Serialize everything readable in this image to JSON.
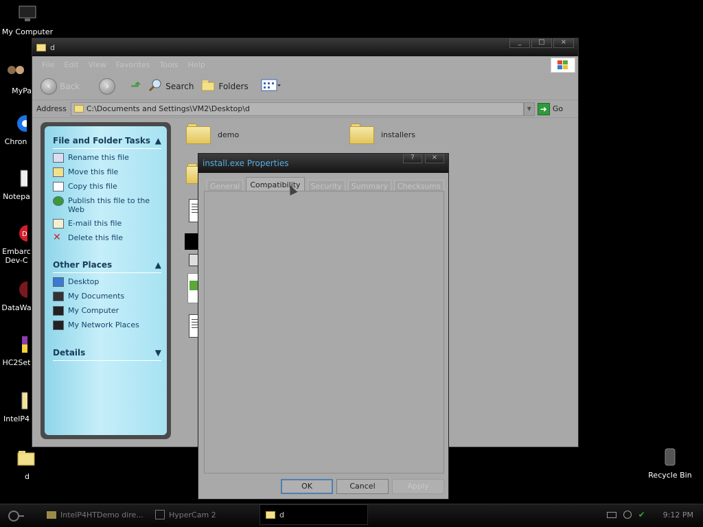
{
  "desktop": {
    "icons": [
      {
        "label": "My Computer",
        "icon": "monitor-icon"
      },
      {
        "label": "MyPa",
        "icon": "app-icon"
      },
      {
        "label": "Chron",
        "icon": "chrome-icon"
      },
      {
        "label": "Notepa",
        "icon": "notepad-icon"
      },
      {
        "label": "Embarc",
        "label2": "Dev-C",
        "icon": "embarcadero-icon"
      },
      {
        "label": "DataWa",
        "icon": "datawa-icon"
      },
      {
        "label": "HC2Set",
        "icon": "installer-icon"
      },
      {
        "label": "IntelP4",
        "icon": "document-icon"
      },
      {
        "label": "d",
        "icon": "folder-icon"
      },
      {
        "label": "Recycle Bin",
        "icon": "recycle-bin-icon"
      }
    ]
  },
  "explorer": {
    "title": "d",
    "menu": [
      "File",
      "Edit",
      "View",
      "Favorites",
      "Tools",
      "Help"
    ],
    "toolbar": {
      "back": "Back",
      "search": "Search",
      "folders": "Folders"
    },
    "address": {
      "label": "Address",
      "path": "C:\\Documents and Settings\\VM2\\Desktop\\d",
      "go": "Go"
    },
    "taskpane": {
      "file_tasks": {
        "title": "File and Folder Tasks",
        "items": [
          "Rename this file",
          "Move this file",
          "Copy this file",
          "Publish this file to the Web",
          "E-mail this file",
          "Delete this file"
        ]
      },
      "other_places": {
        "title": "Other Places",
        "items": [
          "Desktop",
          "My Documents",
          "My Computer",
          "My Network Places"
        ]
      },
      "details": {
        "title": "Details"
      }
    },
    "files": [
      {
        "name": "demo",
        "type": "folder"
      },
      {
        "name": "installers",
        "type": "folder"
      }
    ]
  },
  "dialog": {
    "title": "install.exe Properties",
    "tabs": [
      "General",
      "Compatibility",
      "Security",
      "Summary",
      "Checksums"
    ],
    "active_tab": "Compatibility",
    "buttons": {
      "ok": "OK",
      "cancel": "Cancel",
      "apply": "Apply"
    }
  },
  "taskbar": {
    "items": [
      {
        "label": "IntelP4HTDemo dire...",
        "active": false
      },
      {
        "label": "HyperCam 2",
        "active": false
      },
      {
        "label": "d",
        "active": true
      }
    ],
    "clock": "9:12 PM"
  }
}
